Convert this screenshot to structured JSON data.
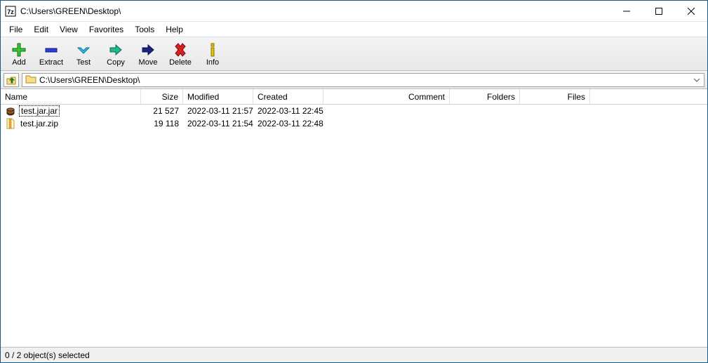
{
  "window": {
    "title": "C:\\Users\\GREEN\\Desktop\\"
  },
  "menu": {
    "file": "File",
    "edit": "Edit",
    "view": "View",
    "favorites": "Favorites",
    "tools": "Tools",
    "help": "Help"
  },
  "toolbar": {
    "add": "Add",
    "extract": "Extract",
    "test": "Test",
    "copy": "Copy",
    "move": "Move",
    "delete": "Delete",
    "info": "Info"
  },
  "path": {
    "value": "C:\\Users\\GREEN\\Desktop\\"
  },
  "columns": {
    "name": "Name",
    "size": "Size",
    "modified": "Modified",
    "created": "Created",
    "comment": "Comment",
    "folders": "Folders",
    "files": "Files"
  },
  "rows": [
    {
      "icon": "jar",
      "name": "test.jar.jar",
      "size": "21 527",
      "modified": "2022-03-11 21:57",
      "created": "2022-03-11 22:45",
      "selected": true
    },
    {
      "icon": "zip",
      "name": "test.jar.zip",
      "size": "19 118",
      "modified": "2022-03-11 21:54",
      "created": "2022-03-11 22:48",
      "selected": false
    }
  ],
  "status": {
    "text": "0 / 2 object(s) selected"
  }
}
